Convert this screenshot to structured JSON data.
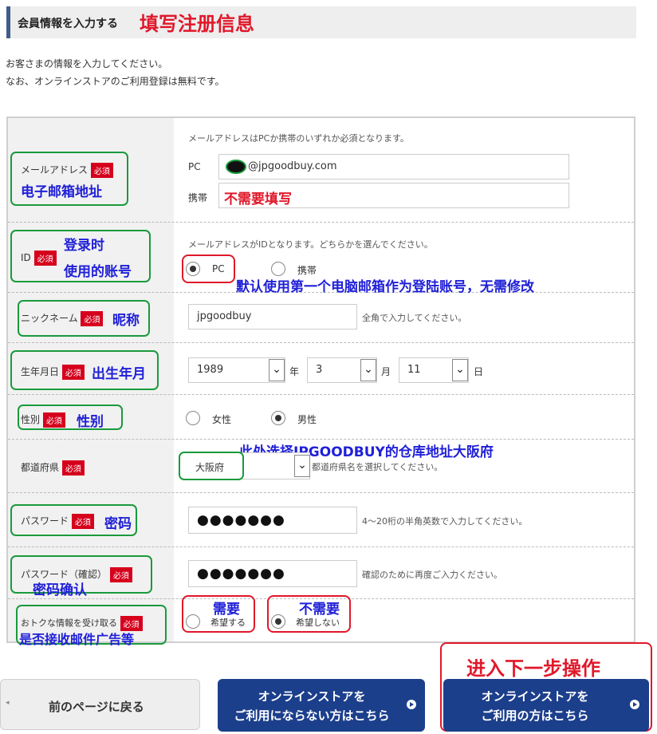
{
  "header": {
    "title": "会員情報を入力する",
    "annotation": "填写注册信息"
  },
  "intro": {
    "line1": "お客さまの情報を入力してください。",
    "line2": "なお、オンラインストアのご利用登録は無料です。"
  },
  "required_badge": "必須",
  "email": {
    "label": "メールアドレス",
    "annotation": "电子邮箱地址",
    "note": "メールアドレスはPCか携帯のいずれか必須となります。",
    "pc_label": "PC",
    "pc_value": "@jpgoodbuy.com",
    "mobile_label": "携帯",
    "mobile_annotation": "不需要填写"
  },
  "id": {
    "label": "ID",
    "annotation_line1": "登录时",
    "annotation_line2": "使用的账号",
    "note": "メールアドレスがIDとなります。どちらかを選んでください。",
    "option_pc": "PC",
    "option_mobile": "携帯",
    "selected": "PC",
    "annotation_default": "默认使用第一个电脑邮箱作为登陆账号，无需修改"
  },
  "nickname": {
    "label": "ニックネーム",
    "annotation": "昵称",
    "value": "jpgoodbuy",
    "hint": "全角で入力してください。"
  },
  "birthday": {
    "label": "生年月日",
    "annotation": "出生年月",
    "year": "1989",
    "year_unit": "年",
    "month": "3",
    "month_unit": "月",
    "day": "11",
    "day_unit": "日"
  },
  "gender": {
    "label": "性別",
    "annotation": "性别",
    "option_female": "女性",
    "option_male": "男性",
    "selected": "男性"
  },
  "prefecture": {
    "label": "都道府県",
    "annotation": "此处选择JPGOODBUY的仓库地址大阪府",
    "value": "大阪府",
    "hint": "都道府県名を選択してください。"
  },
  "password": {
    "label": "パスワード",
    "annotation": "密码",
    "value": "●●●●●●●",
    "hint": "4〜20桁の半角英数で入力してください。"
  },
  "password_confirm": {
    "label": "パスワード（確認）",
    "annotation": "密码确认",
    "value": "●●●●●●●",
    "hint": "確認のために再度ご入力ください。"
  },
  "newsletter": {
    "label": "おトクな情報を受け取る",
    "annotation": "是否接收邮件广告等",
    "option_yes_anno": "需要",
    "option_yes": "希望する",
    "option_no_anno": "不需要",
    "option_no": "希望しない",
    "selected": "希望しない"
  },
  "buttons": {
    "back": "前のページに戻る",
    "guest_line1": "オンラインストアを",
    "guest_line2": "ご利用にならない方はこちら",
    "member_line1": "オンラインストアを",
    "member_line2": "ご利用の方はこちら",
    "next_annotation": "进入下一步操作"
  },
  "colors": {
    "accent_red": "#e0182a",
    "annotation_blue": "#2020d8",
    "outline_green": "#1a9a3c",
    "button_blue": "#1c3f8c",
    "required_red": "#d6001c"
  }
}
